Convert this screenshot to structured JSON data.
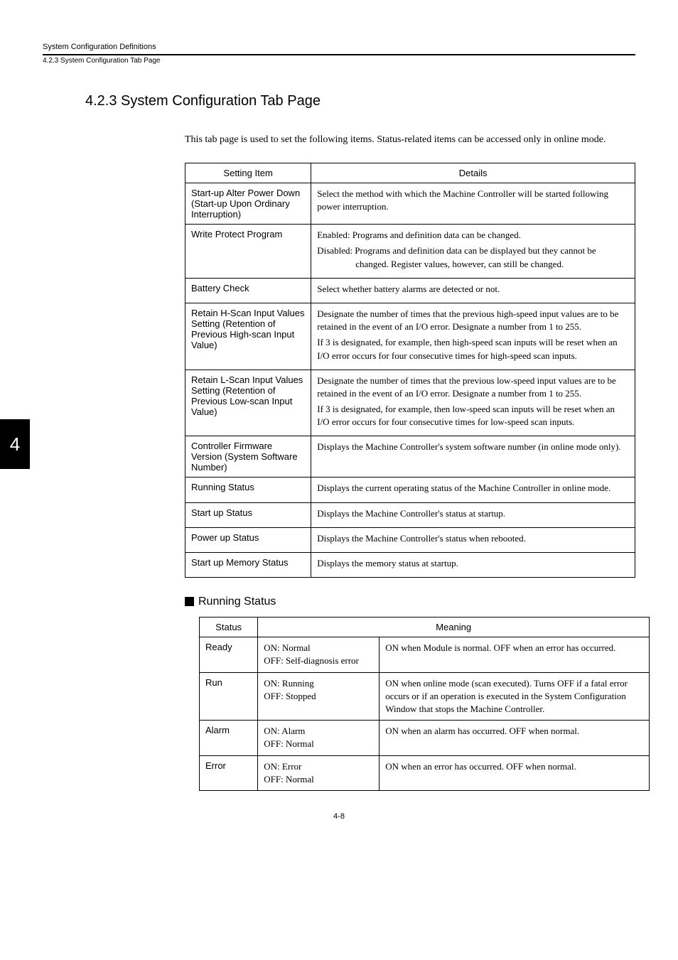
{
  "header": {
    "title": "System Configuration Definitions",
    "subtitle": "4.2.3  System Configuration Tab Page"
  },
  "chapterTab": "4",
  "section": {
    "title": "4.2.3  System Configuration Tab Page",
    "intro": "This tab page is used to set the following items. Status-related items can be accessed only in online mode."
  },
  "mainTable": {
    "headers": {
      "setting": "Setting Item",
      "details": "Details"
    },
    "rows": [
      {
        "setting": "Start-up Alter Power Down (Start-up Upon Ordinary Interruption)",
        "details": [
          "Select the method with which the Machine Controller will be started following power interruption."
        ]
      },
      {
        "setting": "Write Protect Program",
        "details": [
          "Enabled: Programs and definition data can be changed.",
          "Disabled: Programs and definition data can be displayed but they cannot be changed. Register values, however, can still be changed."
        ],
        "indent": true
      },
      {
        "setting": "Battery Check",
        "details": [
          "Select whether battery alarms are detected or not."
        ]
      },
      {
        "setting": "Retain H-Scan Input Values Setting (Retention of Previous High-scan Input Value)",
        "details": [
          "Designate the number of times that the previous high-speed input values are to be retained in the event of an I/O error. Designate a number from 1 to 255.",
          "If 3 is designated, for example, then high-speed scan inputs will be reset when an I/O error occurs for four consecutive times for high-speed scan inputs."
        ]
      },
      {
        "setting": "Retain L-Scan Input Values Setting (Retention of Previous Low-scan Input Value)",
        "details": [
          "Designate the number of times that the previous low-speed input values are to be retained in the event of an I/O error. Designate a number from 1 to 255.",
          "If 3 is designated, for example, then low-speed scan inputs will be reset when an I/O error occurs for four consecutive times for low-speed scan inputs."
        ]
      },
      {
        "setting": "Controller Firmware Version (System Software Number)",
        "details": [
          "Displays the Machine Controller's system software number (in online mode only)."
        ]
      },
      {
        "setting": "Running Status",
        "details": [
          "Displays the current operating status of the Machine Controller in online mode."
        ]
      },
      {
        "setting": "Start up Status",
        "details": [
          "Displays the Machine Controller's status at startup."
        ]
      },
      {
        "setting": "Power up Status",
        "details": [
          "Displays the Machine Controller's status when rebooted."
        ]
      },
      {
        "setting": "Start up Memory Status",
        "details": [
          "Displays the memory status at startup."
        ]
      }
    ]
  },
  "runningStatus": {
    "title": "Running Status",
    "headers": {
      "status": "Status",
      "meaning": "Meaning"
    },
    "rows": [
      {
        "status": "Ready",
        "on": "ON:   Normal",
        "off": "OFF: Self-diagnosis error",
        "desc": "ON when Module is normal. OFF when an error has occurred."
      },
      {
        "status": "Run",
        "on": "ON:   Running",
        "off": "OFF: Stopped",
        "desc": "ON when online mode (scan executed). Turns OFF if a fatal error occurs or if an operation is executed in the System Configuration Window that stops the Machine Controller."
      },
      {
        "status": "Alarm",
        "on": "ON:   Alarm",
        "off": "OFF: Normal",
        "desc": "ON when an alarm has occurred. OFF when normal."
      },
      {
        "status": "Error",
        "on": "ON:   Error",
        "off": "OFF: Normal",
        "desc": "ON when an error has occurred. OFF when normal."
      }
    ]
  },
  "pageNumber": "4-8"
}
